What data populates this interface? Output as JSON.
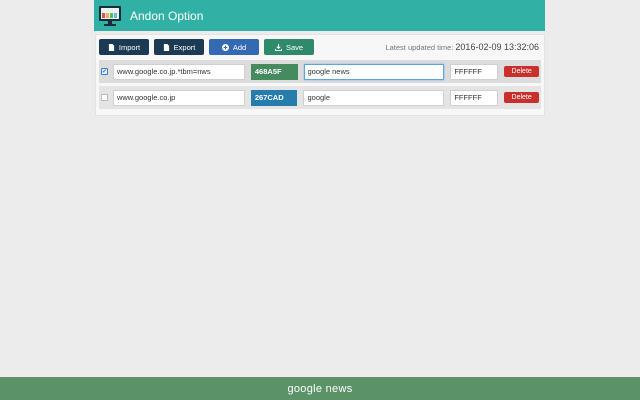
{
  "header": {
    "title": "Andon Option",
    "icon": "monitor-icon"
  },
  "toolbar": {
    "import_label": "Import",
    "export_label": "Export",
    "add_label": "Add",
    "save_label": "Save",
    "updated_label": "Latest updated time:",
    "updated_time": "2016-02-09 13:32:06"
  },
  "rows": [
    {
      "checked": true,
      "url": "www.google.co.jp.*tbm=nws",
      "bg_color": "468A5F",
      "label": "google news",
      "fg_color": "FFFFFF",
      "delete_label": "Delete"
    },
    {
      "checked": false,
      "url": "www.google.co.jp",
      "bg_color": "267CAD",
      "label": "google",
      "fg_color": "FFFFFF",
      "delete_label": "Delete"
    }
  ],
  "footer": {
    "text": "google news",
    "color": "#5b9268"
  },
  "colors": {
    "header": "#31b1a5",
    "row1_chip": "#468A5F",
    "row2_chip": "#267CAD",
    "delete": "#c9302c"
  }
}
